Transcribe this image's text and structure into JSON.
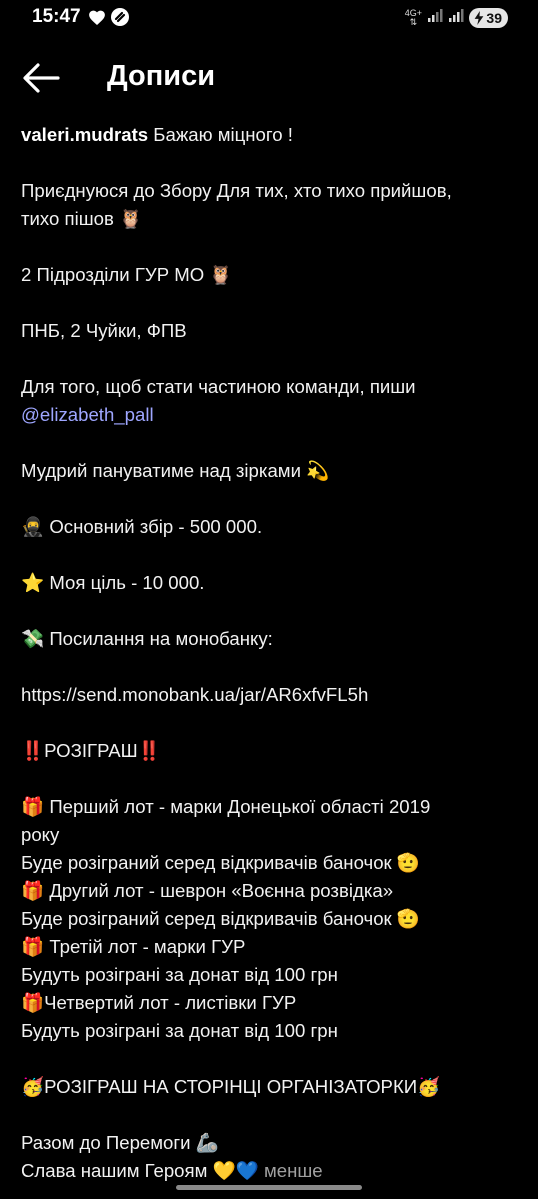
{
  "status_bar": {
    "time": "15:47",
    "network": "4G+",
    "battery": "39"
  },
  "header": {
    "title": "Дописи"
  },
  "post": {
    "username": "valeri.mudrats",
    "lines": {
      "l1": " Бажаю міцного !",
      "l2": "Приєднуюся до Збору Для тих, хто тихо прийшов,",
      "l3": "тихо пішов 🦉",
      "l4": "2 Підрозділи ГУР МО 🦉",
      "l5": "ПНБ, 2 Чуйки, ФПВ",
      "l6": "Для того, щоб стати частиною команди, пиши",
      "mention": "@elizabeth_pall",
      "l7": "Мудрий пануватиме над зірками 💫",
      "l8": "🥷 Основний збір - 500 000.",
      "l9": "⭐ Моя ціль - 10 000.",
      "l10": "💸 Посилання на монобанку:",
      "link": "https://send.monobank.ua/jar/AR6xfvFL5h",
      "l11": "‼️РОЗІГРАШ‼️",
      "l12": "🎁 Перший лот - марки Донецької області 2019",
      "l13": "року",
      "l14": "Буде розіграний серед відкривачів баночок 🫡",
      "l15": "🎁 Другий лот - шеврон «Воєнна розвідка»",
      "l16": "Буде розіграний серед відкривачів баночок 🫡",
      "l17": "🎁 Третій лот - марки ГУР",
      "l18": "Будуть розіграні за донат від 100 грн",
      "l19": "🎁Четвертий лот - листівки ГУР",
      "l20": "Будуть розіграні за донат від 100 грн",
      "l21": "🥳РОЗІГРАШ НА СТОРІНЦІ ОРГАНІЗАТОРКИ🥳",
      "l22": "Разом до Перемоги 🦾",
      "l23": "Слава нашим Героям 💛💙 ",
      "less": "менше"
    }
  },
  "colors": {
    "background": "#000000",
    "text": "#f2f2f2",
    "mention": "#9ea6ff",
    "muted": "#a0a0a0"
  }
}
